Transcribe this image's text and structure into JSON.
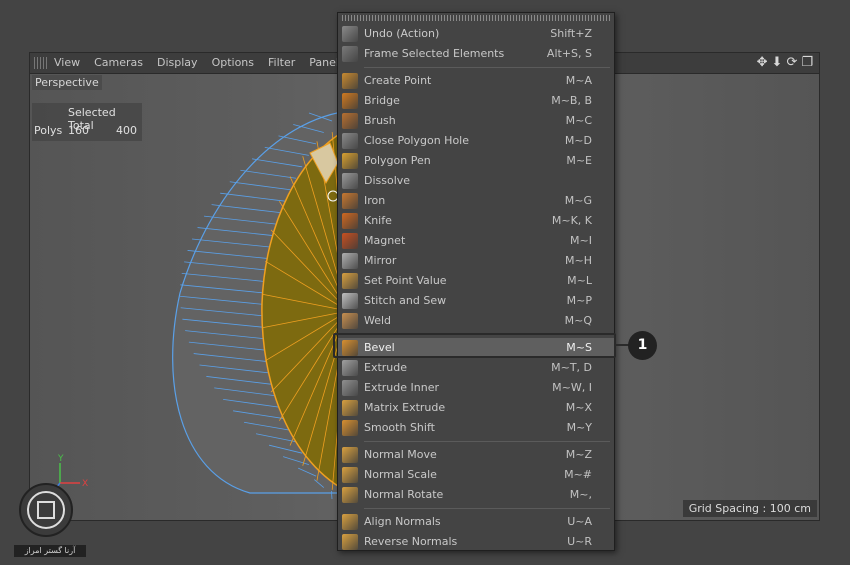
{
  "viewport": {
    "menu": [
      "View",
      "Cameras",
      "Display",
      "Options",
      "Filter",
      "Panel"
    ],
    "tool_icons": [
      "move-icon",
      "down-arrow-icon",
      "rotate-icon",
      "maximize-icon"
    ],
    "label": "Perspective",
    "hud": {
      "header": "Selected Total",
      "row_label": "Polys",
      "selected": "160",
      "total": "400"
    },
    "grid_spacing": "Grid Spacing : 100 cm",
    "axis": {
      "y": "Y",
      "x": "X"
    }
  },
  "menu": {
    "items": [
      {
        "label": "Undo (Action)",
        "shortcut": "Shift+Z",
        "icon": "undo-icon",
        "color": "#8a8a8a"
      },
      {
        "label": "Frame Selected Elements",
        "shortcut": "Alt+S, S",
        "icon": "frame-icon",
        "color": "#7a7a7a"
      },
      {
        "sep": true
      },
      {
        "label": "Create Point",
        "shortcut": "M~A",
        "icon": "create-point-icon",
        "color": "#c88a30"
      },
      {
        "label": "Bridge",
        "shortcut": "M~B, B",
        "icon": "bridge-icon",
        "color": "#d07a20"
      },
      {
        "label": "Brush",
        "shortcut": "M~C",
        "icon": "brush-icon",
        "color": "#b87030"
      },
      {
        "label": "Close Polygon Hole",
        "shortcut": "M~D",
        "icon": "close-hole-icon",
        "color": "#8a8a8a"
      },
      {
        "label": "Polygon Pen",
        "shortcut": "M~E",
        "icon": "polygon-pen-icon",
        "color": "#d8a030"
      },
      {
        "label": "Dissolve",
        "shortcut": "",
        "icon": "dissolve-icon",
        "color": "#9a9a9a"
      },
      {
        "label": "Iron",
        "shortcut": "M~G",
        "icon": "iron-icon",
        "color": "#c87830"
      },
      {
        "label": "Knife",
        "shortcut": "M~K, K",
        "icon": "knife-icon",
        "color": "#d06820"
      },
      {
        "label": "Magnet",
        "shortcut": "M~I",
        "icon": "magnet-icon",
        "color": "#c85020"
      },
      {
        "label": "Mirror",
        "shortcut": "M~H",
        "icon": "mirror-icon",
        "color": "#b0b0b0"
      },
      {
        "label": "Set Point Value",
        "shortcut": "M~L",
        "icon": "set-point-value-icon",
        "color": "#d8a040"
      },
      {
        "label": "Stitch and Sew",
        "shortcut": "M~P",
        "icon": "stitch-icon",
        "color": "#c0c0c0"
      },
      {
        "label": "Weld",
        "shortcut": "M~Q",
        "icon": "weld-icon",
        "color": "#c89050"
      },
      {
        "sep": true
      },
      {
        "label": "Bevel",
        "shortcut": "M~S",
        "icon": "bevel-icon",
        "color": "#d89030",
        "highlight": true
      },
      {
        "label": "Extrude",
        "shortcut": "M~T, D",
        "icon": "extrude-icon",
        "color": "#a0a0a0"
      },
      {
        "label": "Extrude Inner",
        "shortcut": "M~W, I",
        "icon": "extrude-inner-icon",
        "color": "#909090"
      },
      {
        "label": "Matrix Extrude",
        "shortcut": "M~X",
        "icon": "matrix-extrude-icon",
        "color": "#d8a040"
      },
      {
        "label": "Smooth Shift",
        "shortcut": "M~Y",
        "icon": "smooth-shift-icon",
        "color": "#d89030"
      },
      {
        "sep": true
      },
      {
        "label": "Normal Move",
        "shortcut": "M~Z",
        "icon": "normal-move-icon",
        "color": "#d8a040"
      },
      {
        "label": "Normal Scale",
        "shortcut": "M~#",
        "icon": "normal-scale-icon",
        "color": "#d8a040"
      },
      {
        "label": "Normal Rotate",
        "shortcut": "M~,",
        "icon": "normal-rotate-icon",
        "color": "#d8a040"
      },
      {
        "sep": true
      },
      {
        "label": "Align Normals",
        "shortcut": "U~A",
        "icon": "align-normals-icon",
        "color": "#d8a040"
      },
      {
        "label": "Reverse Normals",
        "shortcut": "U~R",
        "icon": "reverse-normals-icon",
        "color": "#d8a040"
      }
    ]
  },
  "callout": {
    "number": "1"
  },
  "watermark": {
    "text": "آرنا گستر امراز"
  },
  "colors": {
    "selection_orange": "#f0a020",
    "face_olive": "#7d6a10",
    "edge_blue": "#5a9ae0"
  }
}
